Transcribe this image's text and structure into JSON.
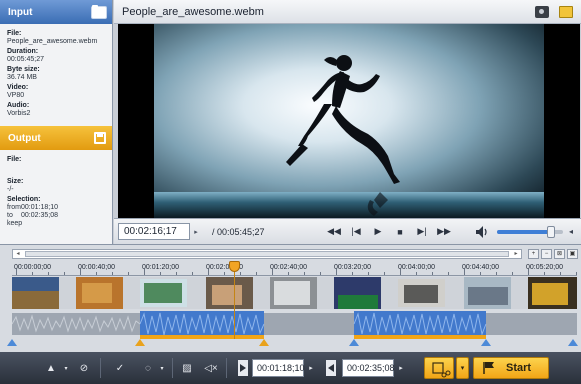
{
  "input_panel": {
    "header": "Input",
    "file_label": "File:",
    "file_value": "People_are_awesome.webm",
    "duration_label": "Duration:",
    "duration_value": "00:05:45;27",
    "bytesize_label": "Byte size:",
    "bytesize_value": "36.74 MB",
    "video_label": "Video:",
    "video_value": "VP80",
    "audio_label": "Audio:",
    "audio_value": "Vorbis2"
  },
  "output_panel": {
    "header": "Output",
    "file_label": "File:",
    "file_value": "",
    "size_label": "Size:",
    "size_value": "-/-",
    "selection_label": "Selection:",
    "from_label": "from",
    "from_value": "00:01:18;10",
    "to_label": "to",
    "to_value": "00:02:35;08",
    "mode_value": "keep"
  },
  "titlebar": {
    "title": "People_are_awesome.webm"
  },
  "player": {
    "current_time": "00:02:16;17",
    "total_time": "/ 00:05:45;27",
    "volume_fraction": 0.82
  },
  "timeline": {
    "ticks": [
      "00:00:00;00",
      "00:00:40;00",
      "00:01:20;00",
      "00:02:00;00",
      "00:02:40;00",
      "00:03:20;00",
      "00:04:00;00",
      "00:04:40;00",
      "00:05:20;00"
    ],
    "playhead_time": "00:02:16;17"
  },
  "bottom": {
    "cut_start": "00:01:18;10",
    "cut_end": "00:02:35;08",
    "start_label": "Start"
  },
  "colors": {
    "input_header": "#3a6db4",
    "output_header": "#e29b10",
    "selection_wave": "#3f7bd0",
    "selection_bar": "#f2a516"
  }
}
